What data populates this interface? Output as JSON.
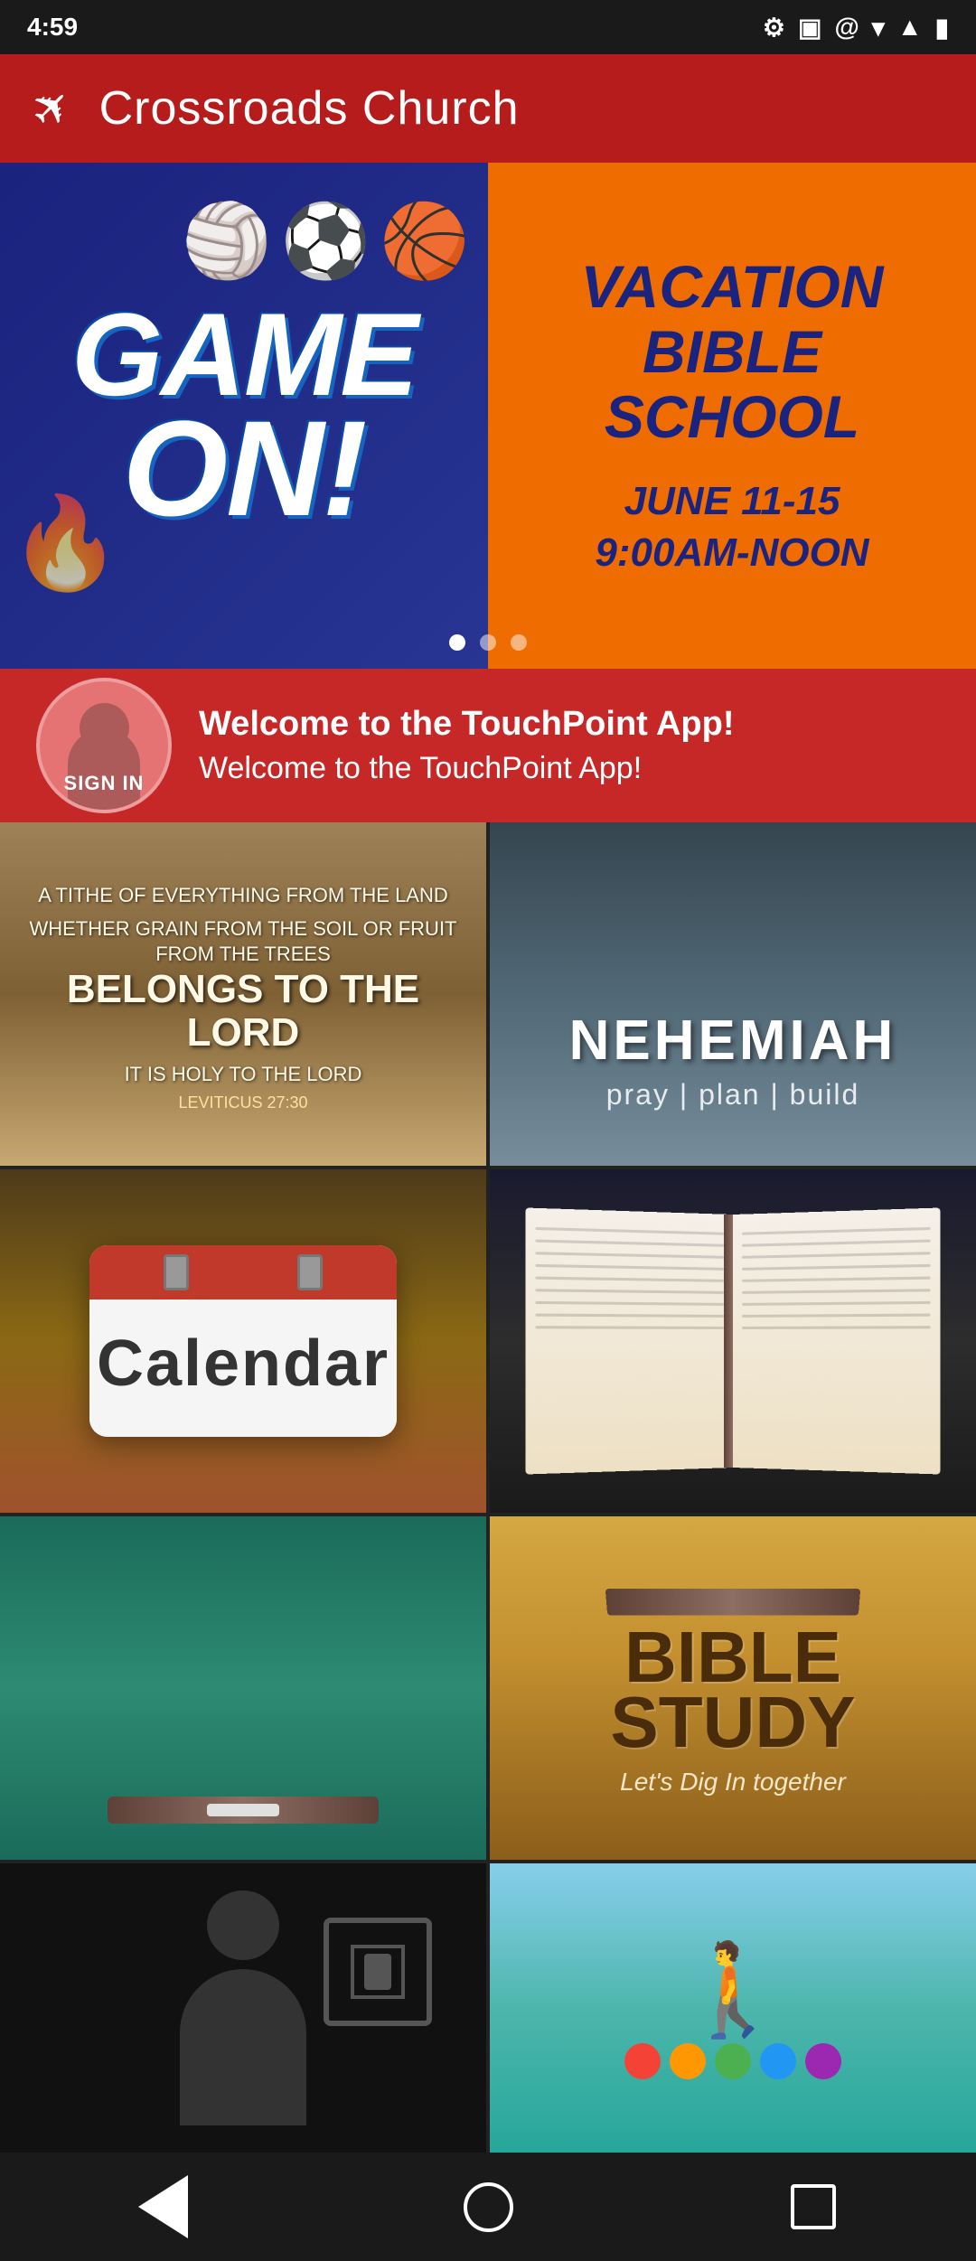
{
  "status_bar": {
    "time": "4:59",
    "icons": [
      "settings",
      "sim-card",
      "at-sign",
      "wifi",
      "signal",
      "battery"
    ]
  },
  "app_bar": {
    "title": "Crossroads Church",
    "icon": "cross-arrow"
  },
  "banner": {
    "slide1": {
      "left_text": "GAME ON!",
      "right_title": "VACATION BIBLE SCHOOL",
      "right_date": "JUNE 11-15",
      "right_time": "9:00AM-NOON"
    },
    "dots": [
      "active",
      "inactive",
      "inactive"
    ]
  },
  "welcome": {
    "title": "Welcome to the TouchPoint App!",
    "subtitle": "Welcome to the TouchPoint App!",
    "sign_in_label": "SIGN IN"
  },
  "grid": {
    "item1_tithe": {
      "line1": "A TITHE OF EVERYTHING FROM THE LAND",
      "line2": "WHETHER GRAIN FROM THE SOIL OR FRUIT FROM THE TREES",
      "line3": "BELONGS TO THE LORD",
      "line4": "IT IS HOLY TO THE LORD",
      "line5": "LEVITICUS 27:30"
    },
    "item2_nehemiah": {
      "title": "NEHEMIAH",
      "subtitle": "pray | plan | build"
    },
    "item3_calendar": {
      "label": "Calendar"
    },
    "item4_bible": {
      "alt": "Open Bible"
    },
    "item5_chalkboard": {
      "alt": "Chalkboard"
    },
    "item6_bible_study": {
      "title": "BIBLE STUDY",
      "subtitle": "Let's Dig In together"
    },
    "item7_checkin": {
      "alt": "Check In"
    },
    "item8_welcome": {
      "alt": "Welcome"
    }
  },
  "bottom_nav": {
    "back": "back",
    "home": "home",
    "recent": "recent"
  }
}
